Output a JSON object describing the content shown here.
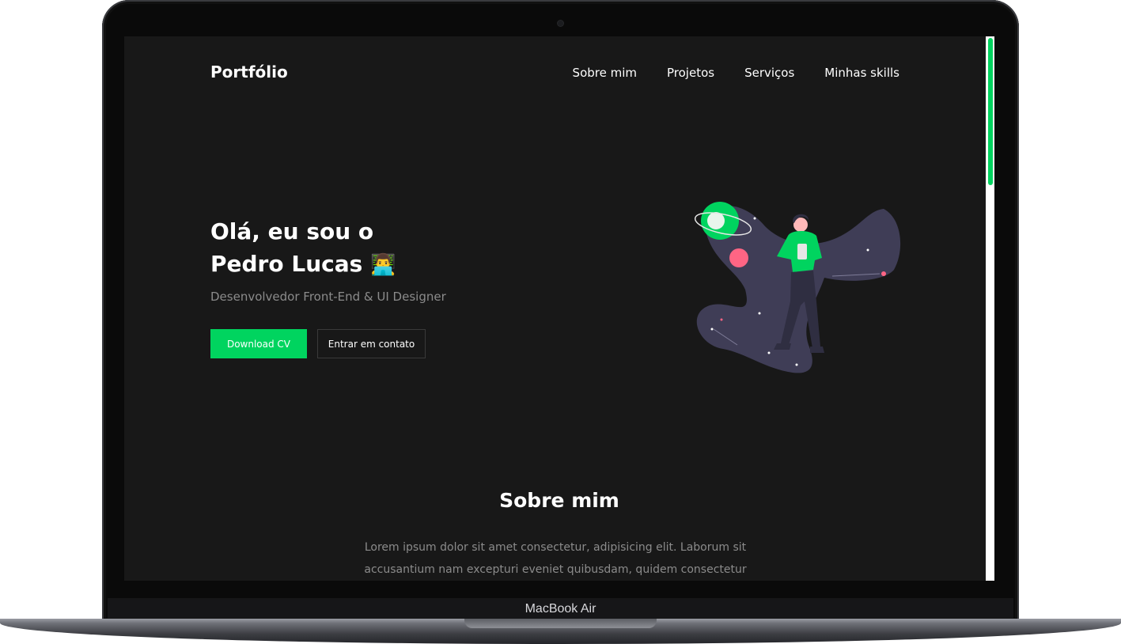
{
  "device": {
    "label": "MacBook Air"
  },
  "colors": {
    "accent": "#00d45f",
    "background": "#181818",
    "text_muted": "#8b8b8b"
  },
  "nav": {
    "logo": "Portfólio",
    "links": [
      "Sobre mim",
      "Projetos",
      "Serviços",
      "Minhas skills"
    ]
  },
  "hero": {
    "title_line1": "Olá, eu sou o",
    "title_line2": "Pedro Lucas",
    "emoji": "👨‍💻",
    "subtitle": "Desenvolvedor Front-End & UI Designer",
    "primary_button": "Download CV",
    "secondary_button": "Entrar em contato",
    "illustration_icon": "space-person-illustration"
  },
  "about": {
    "title": "Sobre mim",
    "text": "Lorem ipsum dolor sit amet consectetur, adipisicing elit. Laborum sit accusantium nam excepturi eveniet quibusdam, quidem consectetur"
  }
}
